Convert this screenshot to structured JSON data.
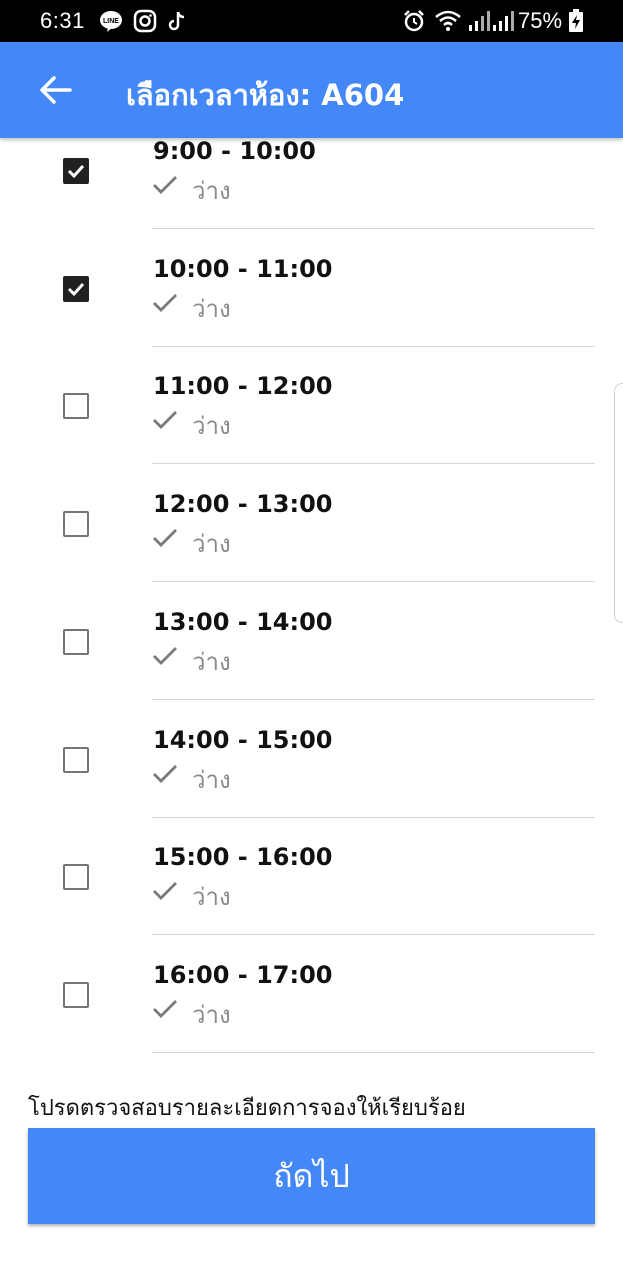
{
  "status_bar": {
    "time": "6:31",
    "battery": "75%",
    "icons": [
      "line-icon",
      "instagram-icon",
      "tiktok-icon",
      "alarm-icon",
      "wifi-icon",
      "signal-icon",
      "signal-icon",
      "battery-charging-icon"
    ]
  },
  "app_bar": {
    "title": "เลือกเวลาห้อง: A604",
    "back_icon": "arrow-back-icon",
    "color": "#4488f8"
  },
  "slots": [
    {
      "time": "9:00 - 10:00",
      "status": "ว่าง",
      "checked": true
    },
    {
      "time": "10:00 - 11:00",
      "status": "ว่าง",
      "checked": true
    },
    {
      "time": "11:00 - 12:00",
      "status": "ว่าง",
      "checked": false
    },
    {
      "time": "12:00 - 13:00",
      "status": "ว่าง",
      "checked": false
    },
    {
      "time": "13:00 - 14:00",
      "status": "ว่าง",
      "checked": false
    },
    {
      "time": "14:00 - 15:00",
      "status": "ว่าง",
      "checked": false
    },
    {
      "time": "15:00 - 16:00",
      "status": "ว่าง",
      "checked": false
    },
    {
      "time": "16:00 - 17:00",
      "status": "ว่าง",
      "checked": false
    }
  ],
  "footer": {
    "note": "โปรดตรวจสอบรายละเอียดการจองให้เรียบร้อย",
    "next_label": "ถัดไป"
  }
}
